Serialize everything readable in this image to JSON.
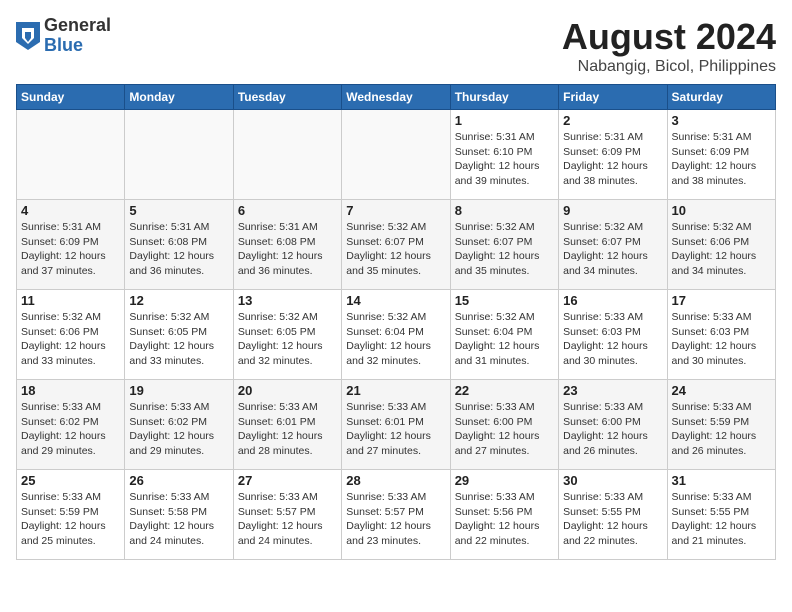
{
  "header": {
    "logo": {
      "general": "General",
      "blue": "Blue"
    },
    "title": "August 2024",
    "location": "Nabangig, Bicol, Philippines"
  },
  "weekdays": [
    "Sunday",
    "Monday",
    "Tuesday",
    "Wednesday",
    "Thursday",
    "Friday",
    "Saturday"
  ],
  "weeks": [
    [
      {
        "day": "",
        "detail": ""
      },
      {
        "day": "",
        "detail": ""
      },
      {
        "day": "",
        "detail": ""
      },
      {
        "day": "",
        "detail": ""
      },
      {
        "day": "1",
        "detail": "Sunrise: 5:31 AM\nSunset: 6:10 PM\nDaylight: 12 hours\nand 39 minutes."
      },
      {
        "day": "2",
        "detail": "Sunrise: 5:31 AM\nSunset: 6:09 PM\nDaylight: 12 hours\nand 38 minutes."
      },
      {
        "day": "3",
        "detail": "Sunrise: 5:31 AM\nSunset: 6:09 PM\nDaylight: 12 hours\nand 38 minutes."
      }
    ],
    [
      {
        "day": "4",
        "detail": "Sunrise: 5:31 AM\nSunset: 6:09 PM\nDaylight: 12 hours\nand 37 minutes."
      },
      {
        "day": "5",
        "detail": "Sunrise: 5:31 AM\nSunset: 6:08 PM\nDaylight: 12 hours\nand 36 minutes."
      },
      {
        "day": "6",
        "detail": "Sunrise: 5:31 AM\nSunset: 6:08 PM\nDaylight: 12 hours\nand 36 minutes."
      },
      {
        "day": "7",
        "detail": "Sunrise: 5:32 AM\nSunset: 6:07 PM\nDaylight: 12 hours\nand 35 minutes."
      },
      {
        "day": "8",
        "detail": "Sunrise: 5:32 AM\nSunset: 6:07 PM\nDaylight: 12 hours\nand 35 minutes."
      },
      {
        "day": "9",
        "detail": "Sunrise: 5:32 AM\nSunset: 6:07 PM\nDaylight: 12 hours\nand 34 minutes."
      },
      {
        "day": "10",
        "detail": "Sunrise: 5:32 AM\nSunset: 6:06 PM\nDaylight: 12 hours\nand 34 minutes."
      }
    ],
    [
      {
        "day": "11",
        "detail": "Sunrise: 5:32 AM\nSunset: 6:06 PM\nDaylight: 12 hours\nand 33 minutes."
      },
      {
        "day": "12",
        "detail": "Sunrise: 5:32 AM\nSunset: 6:05 PM\nDaylight: 12 hours\nand 33 minutes."
      },
      {
        "day": "13",
        "detail": "Sunrise: 5:32 AM\nSunset: 6:05 PM\nDaylight: 12 hours\nand 32 minutes."
      },
      {
        "day": "14",
        "detail": "Sunrise: 5:32 AM\nSunset: 6:04 PM\nDaylight: 12 hours\nand 32 minutes."
      },
      {
        "day": "15",
        "detail": "Sunrise: 5:32 AM\nSunset: 6:04 PM\nDaylight: 12 hours\nand 31 minutes."
      },
      {
        "day": "16",
        "detail": "Sunrise: 5:33 AM\nSunset: 6:03 PM\nDaylight: 12 hours\nand 30 minutes."
      },
      {
        "day": "17",
        "detail": "Sunrise: 5:33 AM\nSunset: 6:03 PM\nDaylight: 12 hours\nand 30 minutes."
      }
    ],
    [
      {
        "day": "18",
        "detail": "Sunrise: 5:33 AM\nSunset: 6:02 PM\nDaylight: 12 hours\nand 29 minutes."
      },
      {
        "day": "19",
        "detail": "Sunrise: 5:33 AM\nSunset: 6:02 PM\nDaylight: 12 hours\nand 29 minutes."
      },
      {
        "day": "20",
        "detail": "Sunrise: 5:33 AM\nSunset: 6:01 PM\nDaylight: 12 hours\nand 28 minutes."
      },
      {
        "day": "21",
        "detail": "Sunrise: 5:33 AM\nSunset: 6:01 PM\nDaylight: 12 hours\nand 27 minutes."
      },
      {
        "day": "22",
        "detail": "Sunrise: 5:33 AM\nSunset: 6:00 PM\nDaylight: 12 hours\nand 27 minutes."
      },
      {
        "day": "23",
        "detail": "Sunrise: 5:33 AM\nSunset: 6:00 PM\nDaylight: 12 hours\nand 26 minutes."
      },
      {
        "day": "24",
        "detail": "Sunrise: 5:33 AM\nSunset: 5:59 PM\nDaylight: 12 hours\nand 26 minutes."
      }
    ],
    [
      {
        "day": "25",
        "detail": "Sunrise: 5:33 AM\nSunset: 5:59 PM\nDaylight: 12 hours\nand 25 minutes."
      },
      {
        "day": "26",
        "detail": "Sunrise: 5:33 AM\nSunset: 5:58 PM\nDaylight: 12 hours\nand 24 minutes."
      },
      {
        "day": "27",
        "detail": "Sunrise: 5:33 AM\nSunset: 5:57 PM\nDaylight: 12 hours\nand 24 minutes."
      },
      {
        "day": "28",
        "detail": "Sunrise: 5:33 AM\nSunset: 5:57 PM\nDaylight: 12 hours\nand 23 minutes."
      },
      {
        "day": "29",
        "detail": "Sunrise: 5:33 AM\nSunset: 5:56 PM\nDaylight: 12 hours\nand 22 minutes."
      },
      {
        "day": "30",
        "detail": "Sunrise: 5:33 AM\nSunset: 5:55 PM\nDaylight: 12 hours\nand 22 minutes."
      },
      {
        "day": "31",
        "detail": "Sunrise: 5:33 AM\nSunset: 5:55 PM\nDaylight: 12 hours\nand 21 minutes."
      }
    ]
  ]
}
